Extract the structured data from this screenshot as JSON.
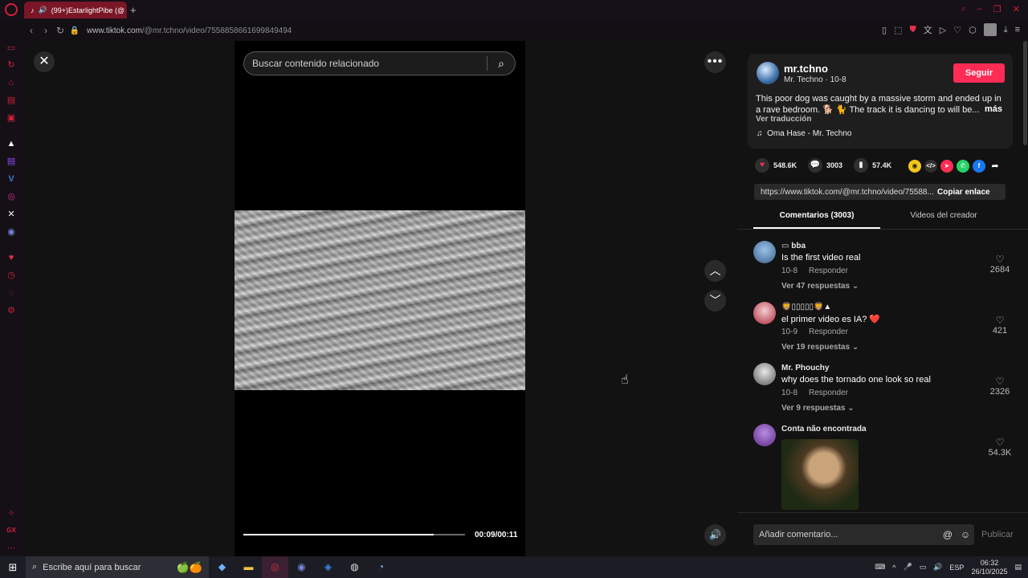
{
  "browser": {
    "tab_title": "(99+)EstarlightPibe (@",
    "url_host": "www.tiktok.com",
    "url_path": "/@mr.tchno/video/7558858661699849494"
  },
  "video": {
    "search_placeholder": "Buscar contenido relacionado",
    "time": "00:09/00:11",
    "progress": 0.86
  },
  "author": {
    "name": "mr.tchno",
    "meta": "Mr. Techno · 10-8",
    "follow_label": "Seguir",
    "description": "This poor dog was caught by a massive storm and ended up in a rave bedroom. 🐕 🐈 The track it is dancing to will be...",
    "more_label": "más",
    "translate_label": "Ver traducción",
    "music": "Oma Hase - Mr. Techno"
  },
  "stats": {
    "likes": "548.6K",
    "comments": "3003",
    "saves": "57.4K"
  },
  "share": {
    "link": "https://www.tiktok.com/@mr.tchno/video/75588...",
    "copy_label": "Copiar enlace"
  },
  "tabs": {
    "comments": "Comentarios (3003)",
    "creator_videos": "Videos del creador"
  },
  "comments": [
    {
      "user": "bba",
      "text": "Is the first video real",
      "date": "10-8",
      "reply": "Responder",
      "replies": "Ver 47 respuestas",
      "likes": "2684"
    },
    {
      "user": "🦁▯▯▯▯▯🦁▲",
      "text": "el primer video es IA? ❤️",
      "date": "10-9",
      "reply": "Responder",
      "replies": "Ver 19 respuestas",
      "likes": "421"
    },
    {
      "user": "Mr. Phouchy",
      "text": "why does the tornado one look so real",
      "date": "10-8",
      "reply": "Responder",
      "replies": "Ver 9 respuestas",
      "likes": "2326"
    },
    {
      "user": "Conta não encontrada",
      "likes": "54.3K"
    }
  ],
  "composer": {
    "placeholder": "Añadir comentario...",
    "publish_label": "Publicar"
  },
  "taskbar": {
    "search_placeholder": "Escribe aquí para buscar",
    "lang": "ESP",
    "time": "06:32",
    "date": "26/10/2025"
  },
  "colors": {
    "accent": "#fe2c55",
    "tab_active": "#7a1626"
  }
}
